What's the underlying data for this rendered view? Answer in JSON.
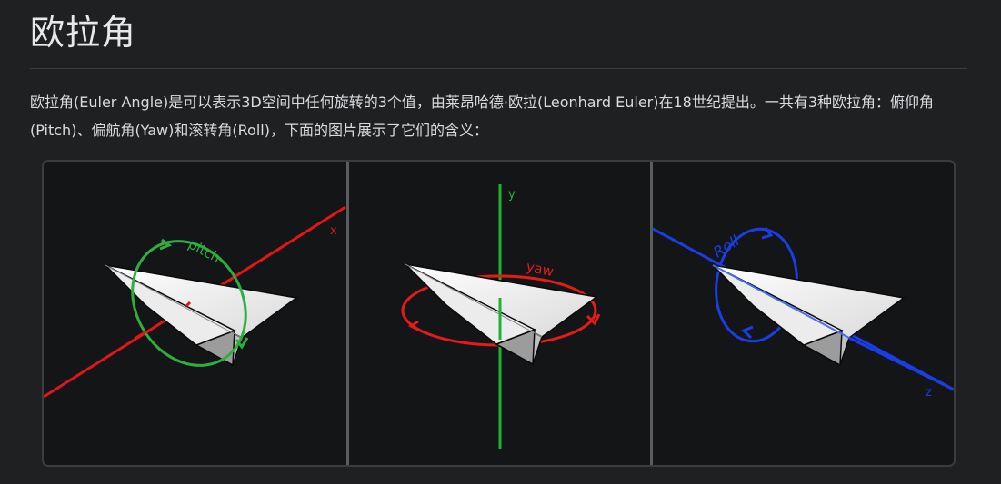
{
  "page": {
    "title": "欧拉角",
    "intro": "欧拉角(Euler Angle)是可以表示3D空间中任何旋转的3个值，由莱昂哈德·欧拉(Leonhard Euler)在18世纪提出。一共有3种欧拉角：俯仰角(Pitch)、偏航角(Yaw)和滚转角(Roll)，下面的图片展示了它们的含义："
  },
  "figure": {
    "panels": [
      {
        "axis": "x",
        "rotation": "pitch",
        "color": "#e0161a"
      },
      {
        "axis": "y",
        "rotation": "yaw",
        "color": "#21b233"
      },
      {
        "axis": "z",
        "rotation": "Roll",
        "color": "#1a3de6"
      }
    ],
    "pitch_color": "#2fae40",
    "yaw_color": "#e31b1b",
    "roll_color": "#1a3de6",
    "background": "#141517",
    "divider_color": "#5a5c60"
  }
}
